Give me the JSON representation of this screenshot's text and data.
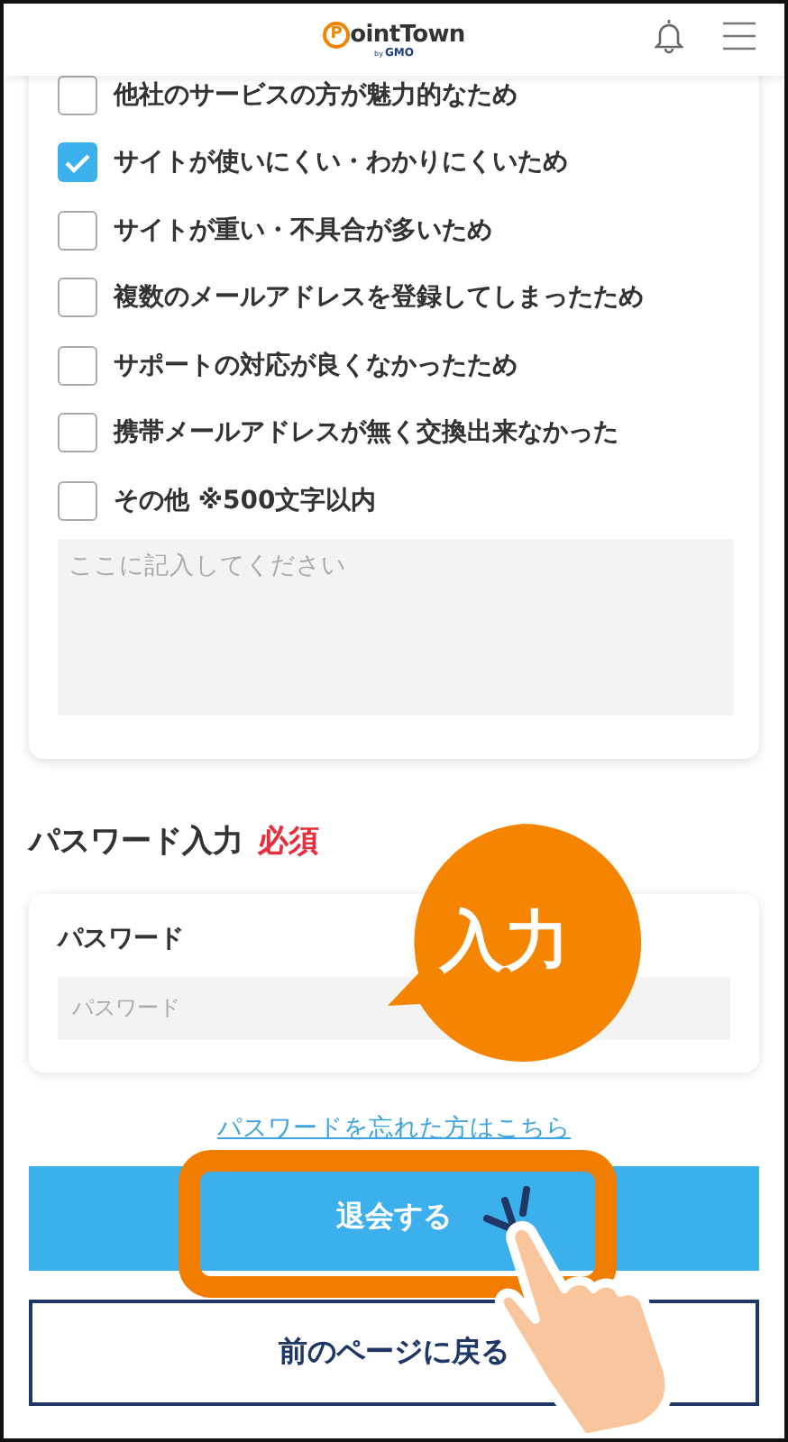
{
  "header": {
    "logo": {
      "mark": "P",
      "name": "ointTown",
      "by": "by",
      "sub": "GMO"
    }
  },
  "reasons": [
    {
      "label": "他社のサービスの方が魅力的なため",
      "checked": false
    },
    {
      "label": "サイトが使いにくい・わかりにくいため",
      "checked": true
    },
    {
      "label": "サイトが重い・不具合が多いため",
      "checked": false
    },
    {
      "label": "複数のメールアドレスを登録してしまったため",
      "checked": false
    },
    {
      "label": "サポートの対応が良くなかったため",
      "checked": false
    },
    {
      "label": "携帯メールアドレスが無く交換出来なかった",
      "checked": false
    },
    {
      "label": "その他 ※500文字以内",
      "checked": false
    }
  ],
  "comment": {
    "placeholder": "ここに記入してください"
  },
  "password_section": {
    "title": "パスワード入力",
    "required": "必須",
    "field_label": "パスワード",
    "placeholder": "パスワード"
  },
  "forgot_link": "パスワードを忘れた方はこちら",
  "submit_button": "退会する",
  "back_button": "前のページに戻る",
  "annotation": {
    "callout": "入力"
  }
}
